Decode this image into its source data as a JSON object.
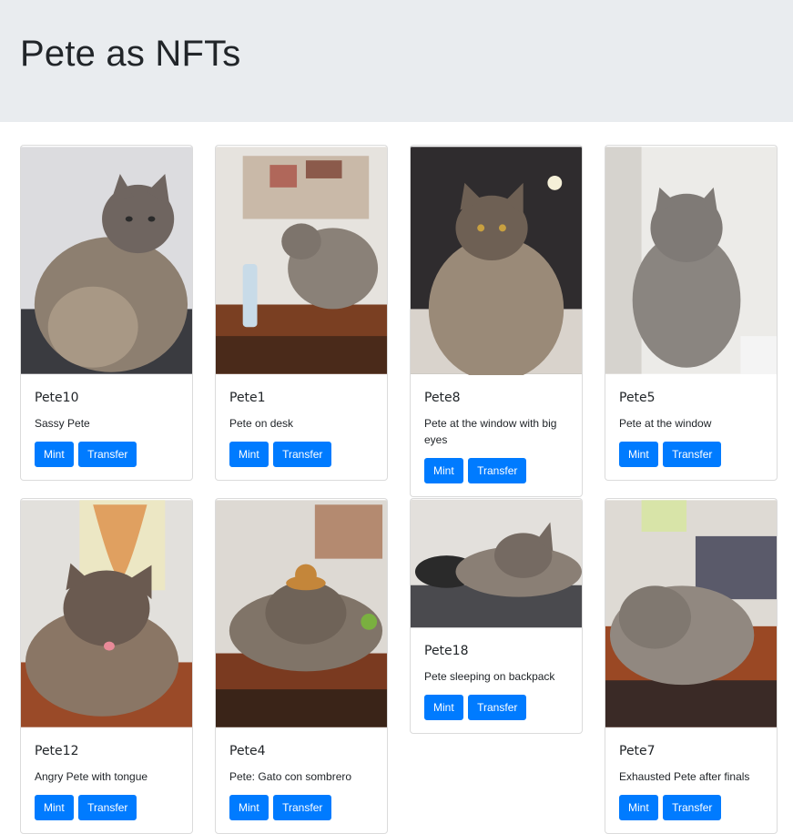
{
  "header": {
    "title": "Pete as NFTs"
  },
  "cards": [
    {
      "name": "Pete10",
      "description": "Sassy Pete",
      "mint_label": "Mint",
      "transfer_label": "Transfer"
    },
    {
      "name": "Pete1",
      "description": "Pete on desk",
      "mint_label": "Mint",
      "transfer_label": "Transfer"
    },
    {
      "name": "Pete8",
      "description": "Pete at the window with big eyes",
      "mint_label": "Mint",
      "transfer_label": "Transfer"
    },
    {
      "name": "Pete5",
      "description": "Pete at the window",
      "mint_label": "Mint",
      "transfer_label": "Transfer"
    },
    {
      "name": "Pete12",
      "description": "Angry Pete with tongue",
      "mint_label": "Mint",
      "transfer_label": "Transfer"
    },
    {
      "name": "Pete4",
      "description": "Pete: Gato con sombrero",
      "mint_label": "Mint",
      "transfer_label": "Transfer"
    },
    {
      "name": "Pete18",
      "description": "Pete sleeping on backpack",
      "mint_label": "Mint",
      "transfer_label": "Transfer"
    },
    {
      "name": "Pete7",
      "description": "Exhausted Pete after finals",
      "mint_label": "Mint",
      "transfer_label": "Transfer"
    }
  ],
  "colors": {
    "primary": "#007bff",
    "jumbotron_bg": "#e9ecef"
  }
}
